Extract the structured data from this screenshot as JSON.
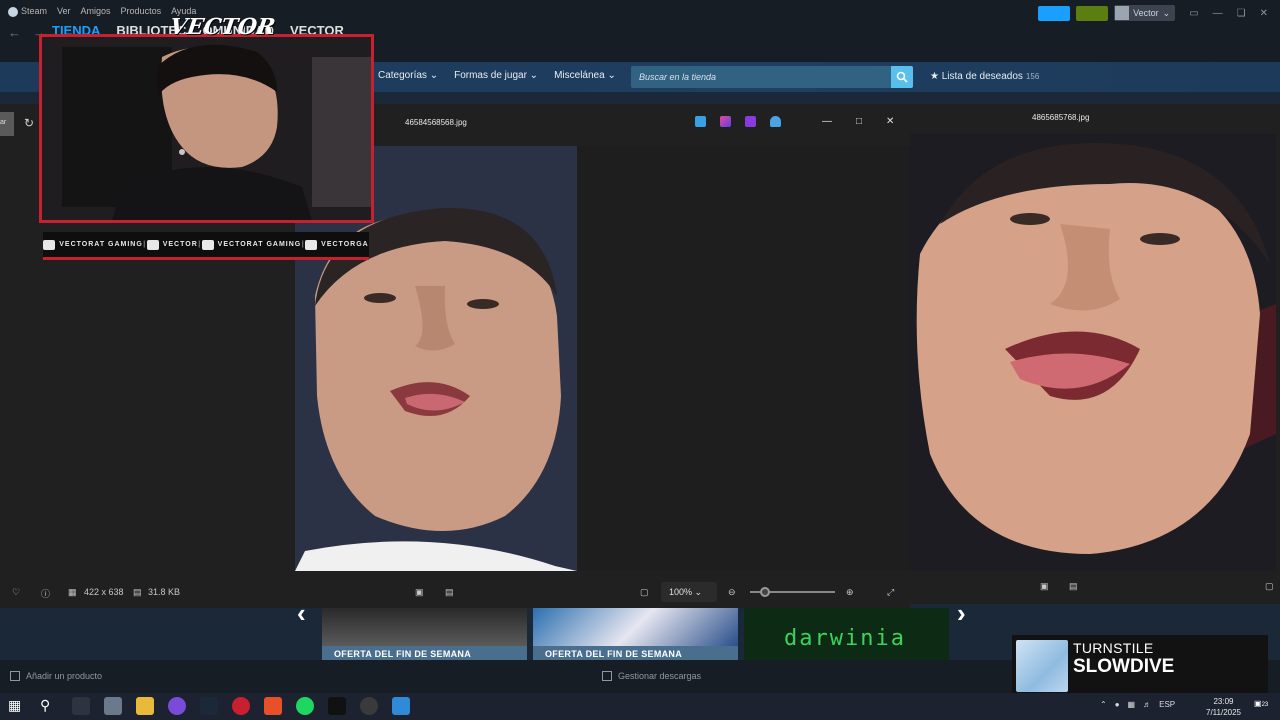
{
  "steam": {
    "menu": [
      "Steam",
      "Ver",
      "Amigos",
      "Productos",
      "Ayuda"
    ],
    "tabs": [
      "TIENDA",
      "BIBLIOTEC",
      "OMUNIDAD",
      "VECTOR"
    ],
    "user": "Vector"
  },
  "store_nav": {
    "items": [
      "Categorías",
      "Formas de jugar",
      "Miscelánea"
    ],
    "search_placeholder": "Buscar en la tienda",
    "wishlist_label": "Lista de deseados",
    "wishlist_count": "156"
  },
  "viewer1": {
    "filename": "46584568568.jpg",
    "dimensions": "422 x 638",
    "filesize": "31.8 KB",
    "zoom": "100%"
  },
  "viewer2": {
    "filename": "4865685768.jpg"
  },
  "left_tab": "ar",
  "carousel": {
    "tile1": "OFERTA DEL FIN DE SEMANA",
    "tile2": "OFERTA DEL FIN DE SEMANA",
    "tile3": "darwinia"
  },
  "footer": {
    "add_product": "Añadir un producto",
    "downloads": "Gestionar descargas"
  },
  "now_playing": {
    "artist": "TURNSTILE",
    "title": "SLOWDIVE"
  },
  "overlay": {
    "brand": "VECTOR",
    "socials": [
      {
        "name": "VECTORAT GAMING"
      },
      {
        "name": "VECTOR"
      },
      {
        "name": "VECTORAT GAMING"
      },
      {
        "name": "VECTORGA"
      }
    ]
  },
  "taskbar": {
    "lang": "ESP",
    "time": "23:09",
    "date": "7/11/2025",
    "notifications": "23"
  },
  "colors": {
    "accent_blue": "#1a9fff",
    "overlay_red": "#c8202e"
  }
}
